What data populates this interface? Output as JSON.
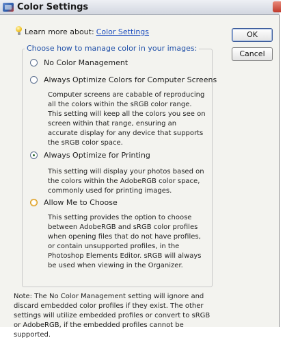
{
  "window": {
    "title": "Color Settings"
  },
  "learn": {
    "prefix": "Learn more about:",
    "link": "Color Settings"
  },
  "group": {
    "legend": "Choose how to manage color in your images:"
  },
  "options": [
    {
      "label": "No Color Management",
      "selected": false,
      "description": ""
    },
    {
      "label": "Always Optimize Colors for Computer Screens",
      "selected": false,
      "description": "Computer screens are cabable of reproducing all the colors within the sRGB color range. This setting will keep all the colors you see on screen within that range, ensuring an accurate display for any device that supports the sRGB color space."
    },
    {
      "label": "Always Optimize for Printing",
      "selected": true,
      "description": "This setting will display your photos based on the colors within the AdobeRGB color space, commonly used for printing images."
    },
    {
      "label": "Allow Me to Choose",
      "selected": false,
      "description": "This setting provides the option to choose between AdobeRGB and sRGB color profiles when opening files that do not have profiles, or contain unsupported profiles, in the Photoshop Elements Editor. sRGB will always be used when viewing in the Organizer."
    }
  ],
  "buttons": {
    "ok": "OK",
    "cancel": "Cancel"
  },
  "note": "Note: The No Color Management setting will ignore and discard embedded color profiles if they exist. The other settings will utilize embedded profiles or convert to sRGB or AdobeRGB, if the embedded profiles cannot be supported.",
  "colors": {
    "link": "#1f4fbf",
    "legend": "#1f4fa8",
    "dialog_bg": "#f3f3ef"
  }
}
